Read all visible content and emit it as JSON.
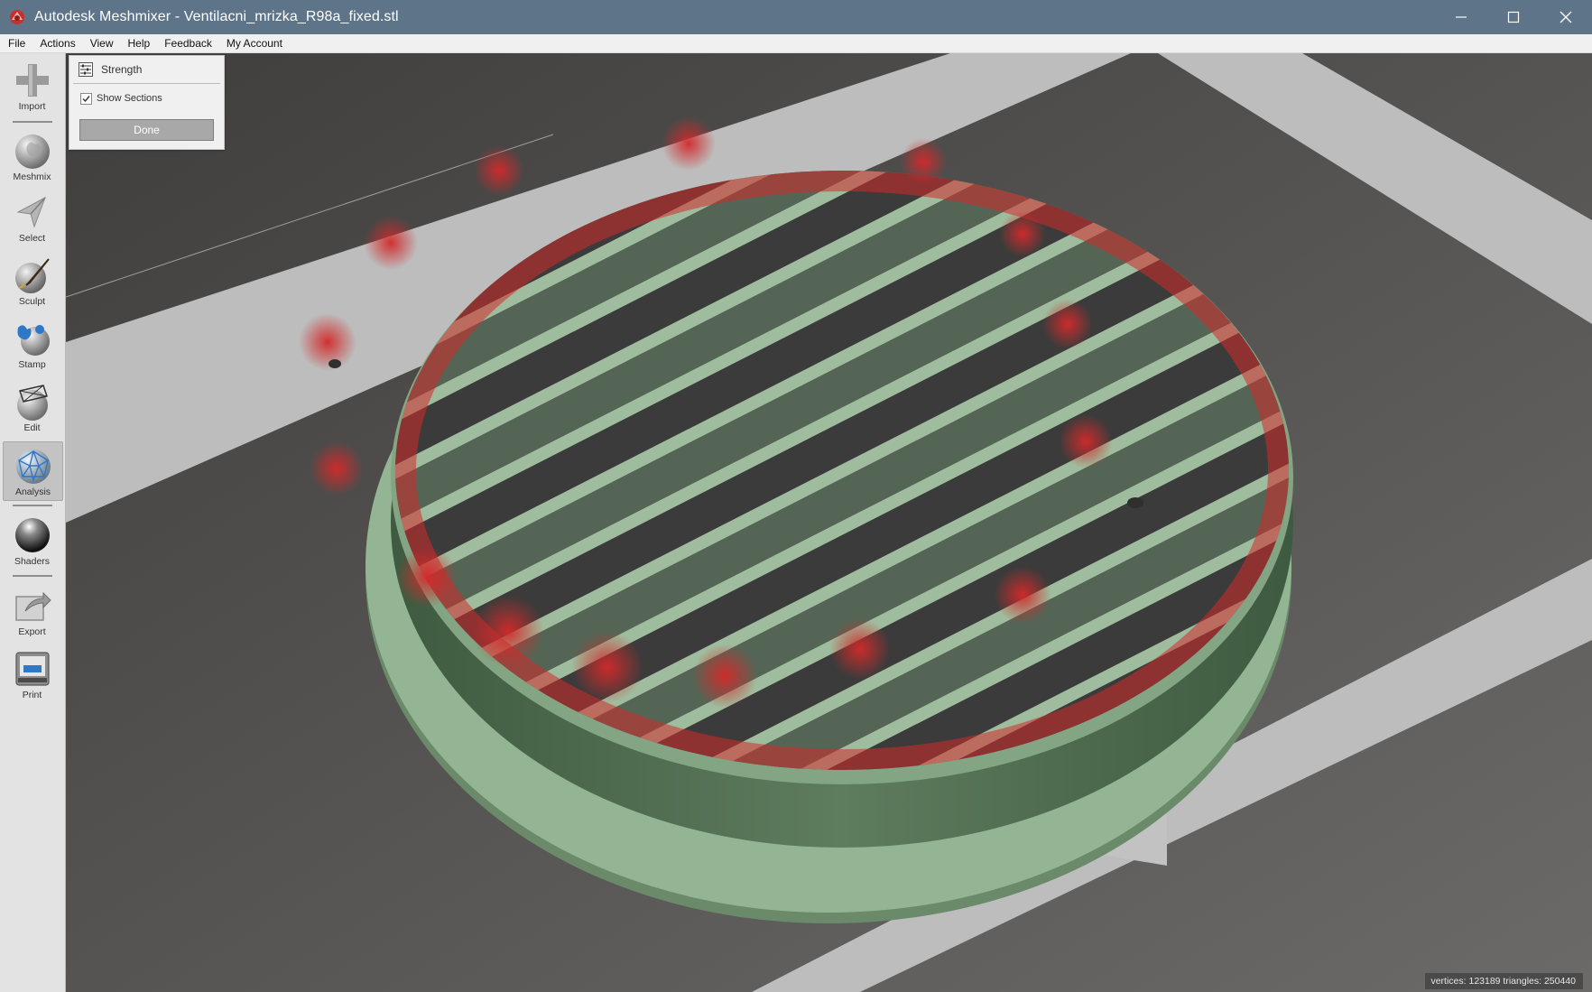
{
  "window": {
    "title": "Autodesk Meshmixer - Ventilacni_mrizka_R98a_fixed.stl"
  },
  "menu": {
    "items": [
      "File",
      "Actions",
      "View",
      "Help",
      "Feedback",
      "My Account"
    ]
  },
  "toolbar": {
    "items": [
      {
        "label": "Import",
        "icon": "import-plus-icon"
      },
      {
        "label": "Meshmix",
        "icon": "meshmix-bunny-icon"
      },
      {
        "label": "Select",
        "icon": "select-arrow-icon"
      },
      {
        "label": "Sculpt",
        "icon": "sculpt-brush-icon"
      },
      {
        "label": "Stamp",
        "icon": "stamp-icon"
      },
      {
        "label": "Edit",
        "icon": "edit-sphere-icon"
      },
      {
        "label": "Analysis",
        "icon": "analysis-sphere-icon",
        "active": true
      },
      {
        "label": "Shaders",
        "icon": "shaders-sphere-icon"
      },
      {
        "label": "Export",
        "icon": "export-icon"
      },
      {
        "label": "Print",
        "icon": "print-icon"
      }
    ]
  },
  "panel": {
    "title": "Strength",
    "show_sections_label": "Show Sections",
    "show_sections_checked": true,
    "done_label": "Done"
  },
  "status": {
    "text": "vertices: 123189 triangles: 250440"
  },
  "colors": {
    "titlebar": "#5e7489",
    "mesh_green": "#94b593",
    "stress_red": "#d22a2a",
    "floor_dark": "#5f5d5b",
    "platform_light": "#bdbdbd"
  }
}
